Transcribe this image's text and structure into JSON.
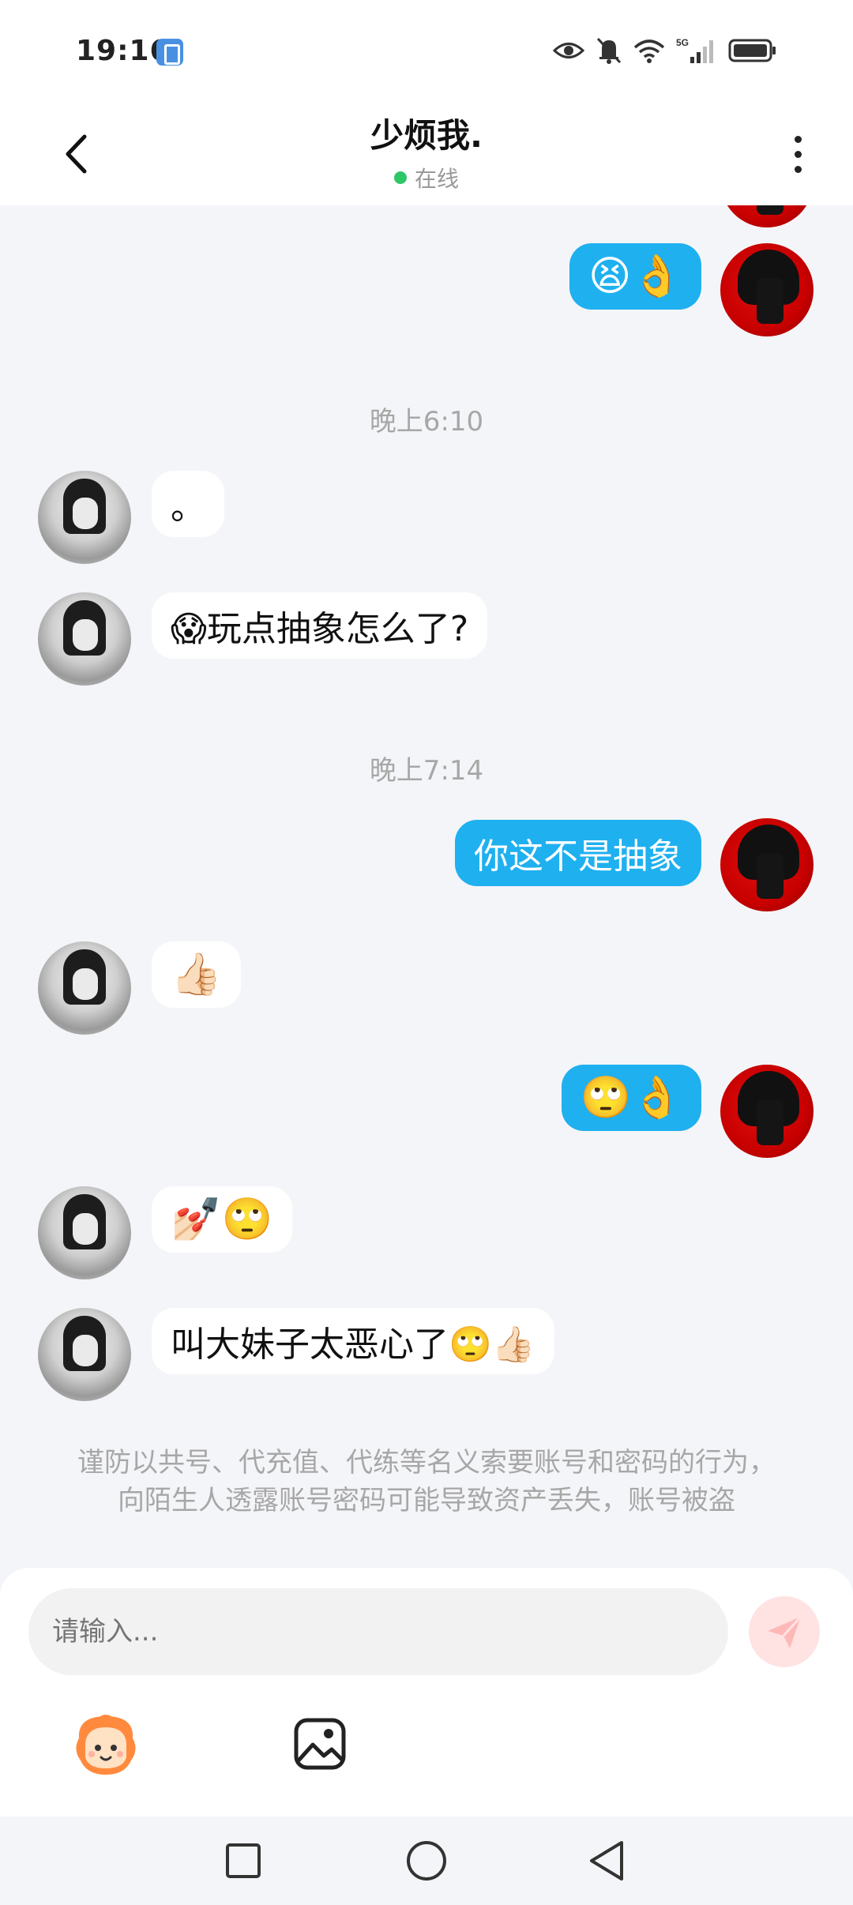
{
  "status_bar": {
    "time": "19:16",
    "network_label": "5G",
    "icons": [
      "sim-card-icon",
      "eye-icon",
      "bell-mute-icon",
      "wifi-icon",
      "signal-icon",
      "battery-icon"
    ]
  },
  "header": {
    "title": "少烦我.",
    "status": "在线",
    "status_color": "#2ec766",
    "back_icon": "chevron-left-icon",
    "more_icon": "more-vertical-icon"
  },
  "messages": [
    {
      "side": "out",
      "content": "😫👌"
    },
    {
      "type": "timestamp",
      "text": "晚上6:10"
    },
    {
      "side": "in",
      "content": "。"
    },
    {
      "side": "in",
      "content": "😱玩点抽象怎么了?"
    },
    {
      "type": "timestamp",
      "text": "晚上7:14"
    },
    {
      "side": "out",
      "content": "你这不是抽象"
    },
    {
      "side": "in",
      "content": "👍🏻"
    },
    {
      "side": "out",
      "content": "🙄👌"
    },
    {
      "side": "in",
      "content": "💅🏻🙄"
    },
    {
      "side": "in",
      "content": "叫大妹子太恶心了🙄👍🏻"
    }
  ],
  "warning": {
    "line1": "谨防以共号、代充值、代练等名义索要账号和密码的行为，",
    "line2": "向陌生人透露账号密码可能导致资产丢失，账号被盗"
  },
  "input": {
    "placeholder": "请输入..."
  },
  "toolbar": {
    "sticker_icon": "sticker-icon",
    "image_icon": "image-icon",
    "send_icon": "send-icon"
  },
  "colors": {
    "outgoing_bubble": "#1fb0f0",
    "incoming_bubble": "#ffffff",
    "background": "#f4f5f8"
  },
  "navbar": {
    "icons": [
      "recents-square-icon",
      "home-circle-icon",
      "back-triangle-icon"
    ]
  }
}
